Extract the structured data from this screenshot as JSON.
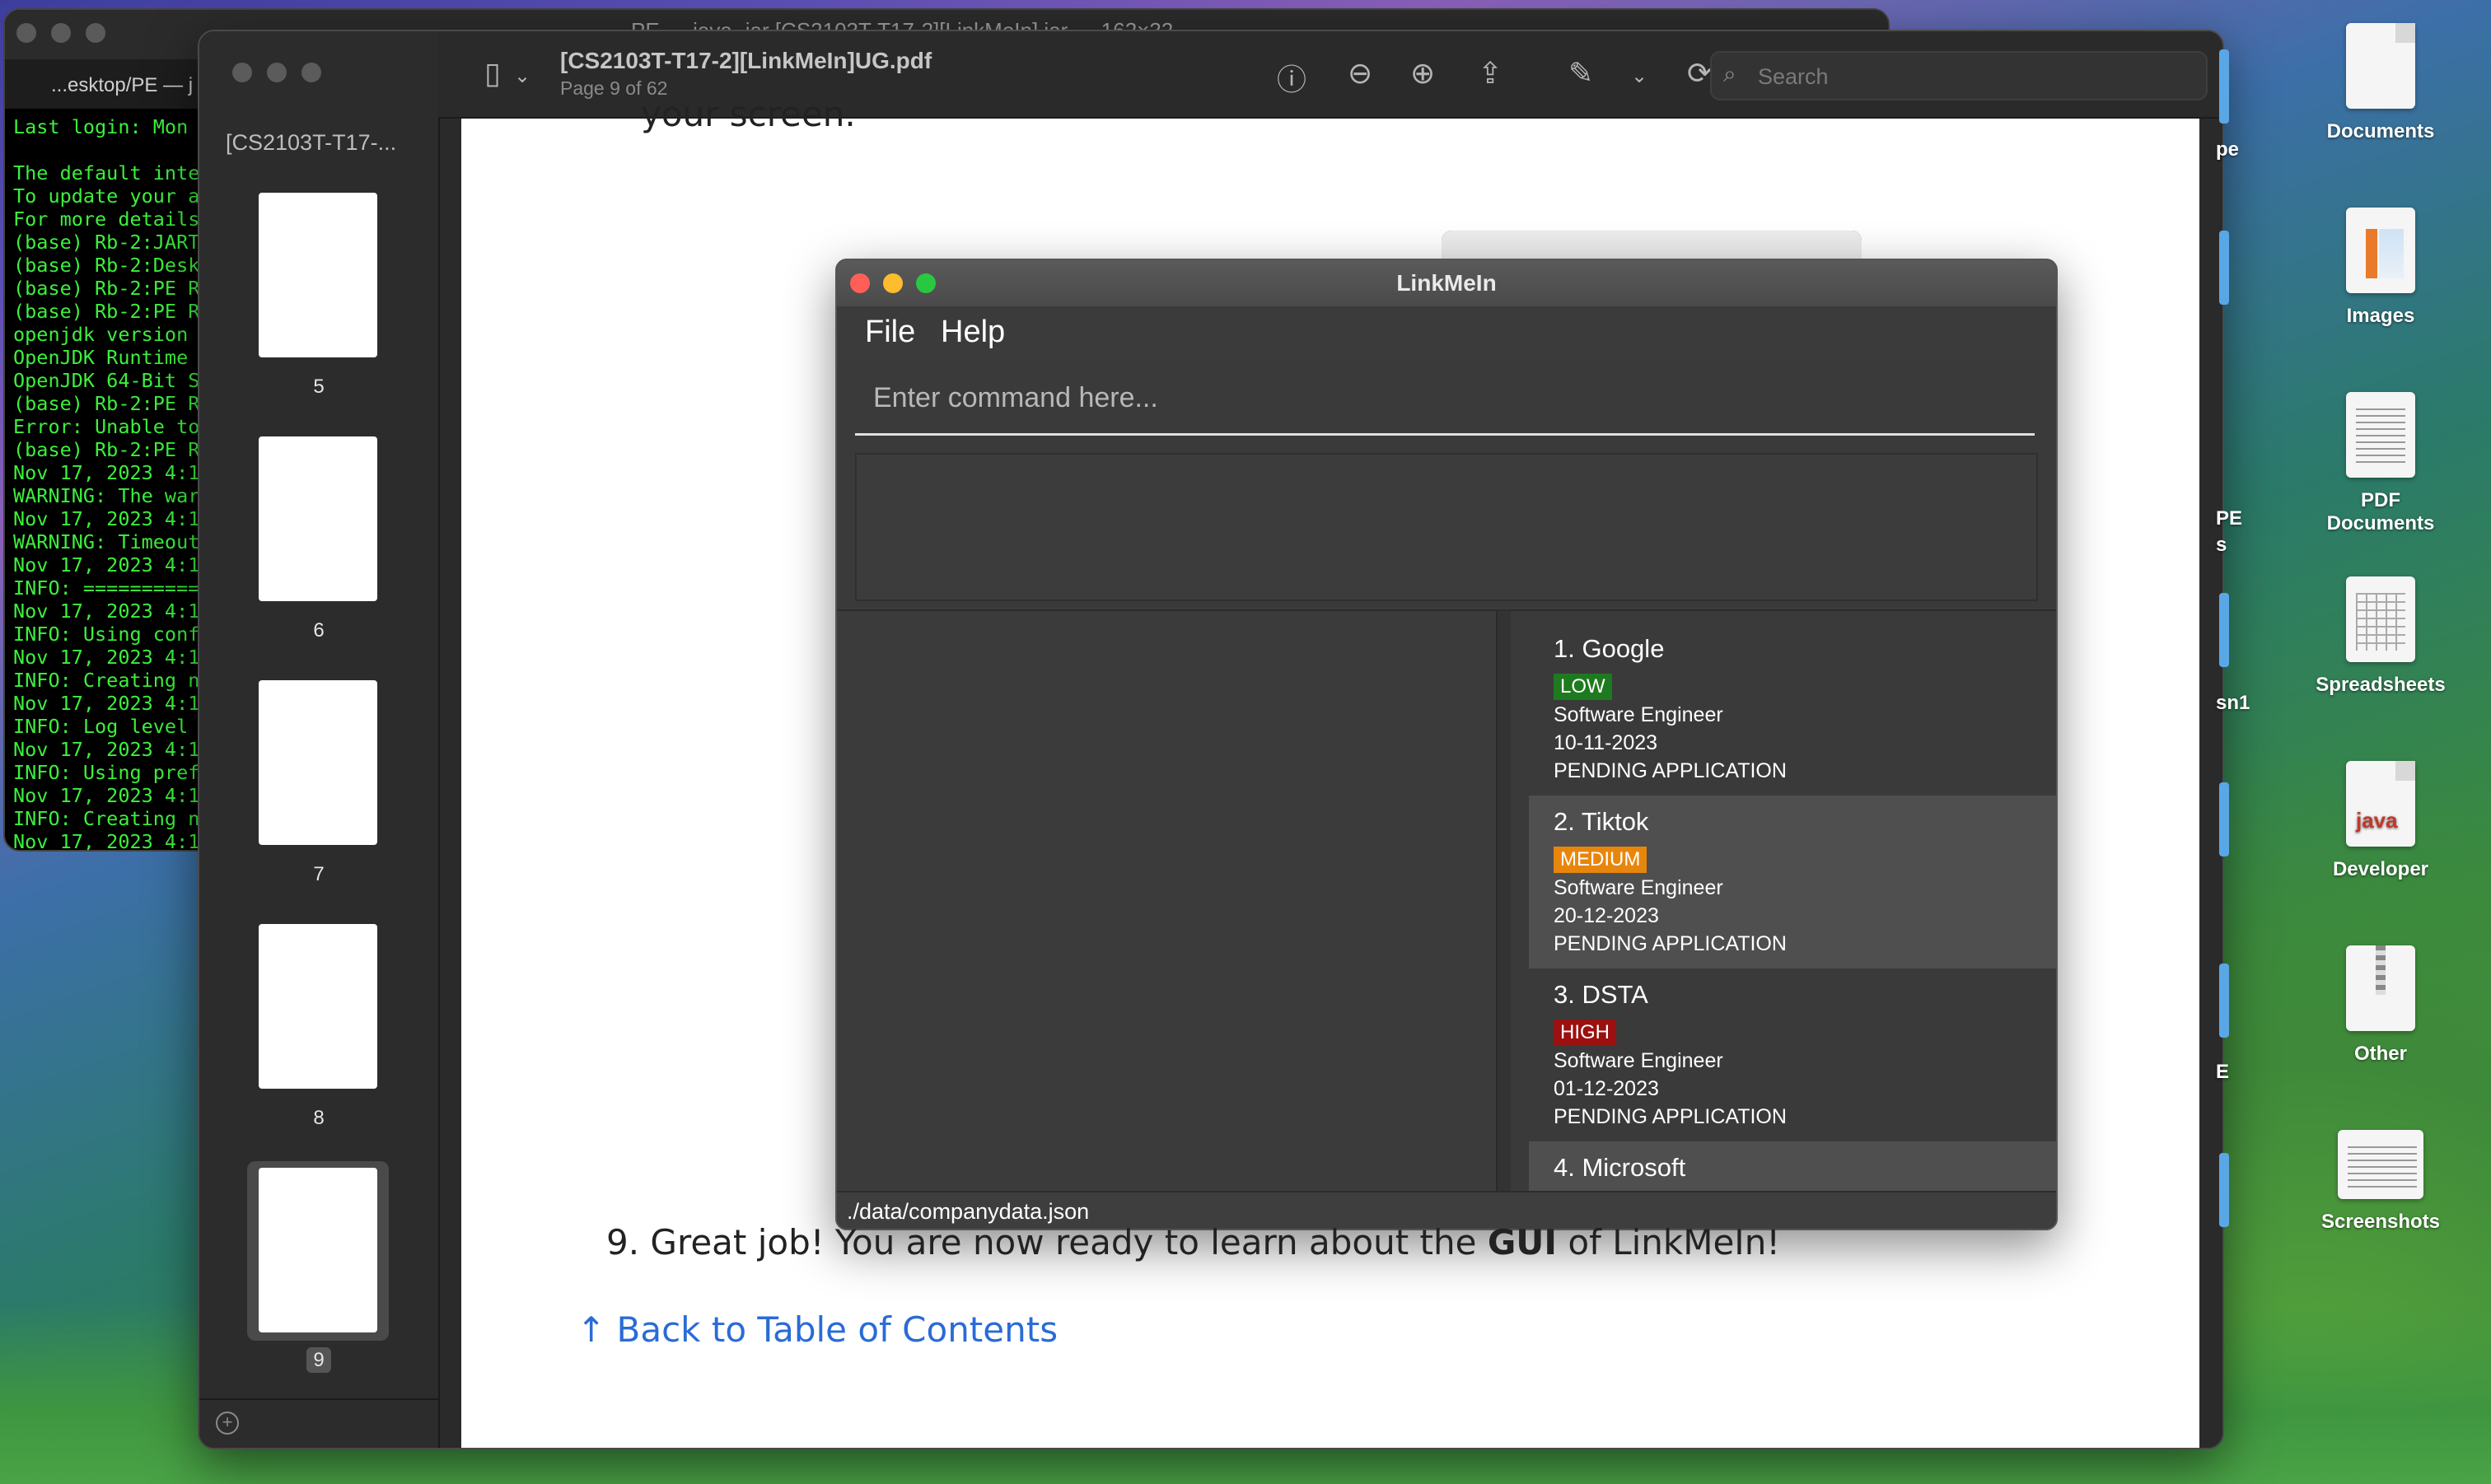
{
  "terminal": {
    "top_title": "PE — java -jar [CS2103T-T17-2][LinkMeIn].jar — 162×32",
    "tab_label": "...esktop/PE — j",
    "lines": [
      "Last login: Mon",
      "",
      "The default inte",
      "To update your a",
      "For more details",
      "(base) Rb-2:JART",
      "(base) Rb-2:Desk",
      "(base) Rb-2:PE R",
      "(base) Rb-2:PE R",
      "openjdk version",
      "OpenJDK Runtime",
      "OpenJDK 64-Bit S",
      "(base) Rb-2:PE R",
      "Error: Unable to",
      "(base) Rb-2:PE R",
      "Nov 17, 2023 4:1",
      "WARNING: The war",
      "Nov 17, 2023 4:1",
      "WARNING: Timeout",
      "Nov 17, 2023 4:1",
      "INFO: ==========",
      "Nov 17, 2023 4:1",
      "INFO: Using conf",
      "Nov 17, 2023 4:1",
      "INFO: Creating n",
      "Nov 17, 2023 4:1",
      "INFO: Log level",
      "Nov 17, 2023 4:1",
      "INFO: Using pref",
      "Nov 17, 2023 4:1",
      "INFO: Creating n",
      "Nov 17, 2023 4:1"
    ]
  },
  "preview": {
    "sidebar_title": "[CS2103T-T17-...",
    "doc_title": "[CS2103T-T17-2][LinkMeIn]UG.pdf",
    "page_info": "Page 9 of 62",
    "search_placeholder": "Search",
    "thumbnails": [
      {
        "num": "5"
      },
      {
        "num": "6"
      },
      {
        "num": "7"
      },
      {
        "num": "8"
      },
      {
        "num": "9"
      }
    ],
    "selected_page": "9",
    "doc_top_text": "your screen.",
    "step_prefix": "9. Great job! You are now ready to learn about the ",
    "step_bold": "GUI",
    "step_suffix": " of LinkMeIn!",
    "back_link": "↑ Back to Table of Contents"
  },
  "linkmein": {
    "title": "LinkMeIn",
    "menu": [
      "File",
      "Help"
    ],
    "command_placeholder": "Enter command here...",
    "status_path": "./data/companydata.json",
    "companies": [
      {
        "name": "1.  Google",
        "priority": "LOW",
        "priority_color": "#1e7a1e",
        "role": "Software Engineer",
        "date": "10-11-2023",
        "status": "PENDING APPLICATION"
      },
      {
        "name": "2.  Tiktok",
        "priority": "MEDIUM",
        "priority_color": "#e8860c",
        "role": "Software Engineer",
        "date": "20-12-2023",
        "status": "PENDING APPLICATION"
      },
      {
        "name": "3.  DSTA",
        "priority": "HIGH",
        "priority_color": "#9b1010",
        "role": "Software Engineer",
        "date": "01-12-2023",
        "status": "PENDING APPLICATION"
      },
      {
        "name": "4.  Microsoft"
      }
    ]
  },
  "desktop": {
    "icons": [
      "Documents",
      "Images",
      "PDF Documents",
      "Spreadsheets",
      "Developer",
      "Other",
      "Screenshots"
    ],
    "partial_labels": [
      "pe",
      "PE",
      "s",
      "sn1",
      "E"
    ]
  },
  "colors": {
    "terminal_text": "#3cf03c",
    "link": "#2a6bd6",
    "traffic_red": "#ff5f57",
    "traffic_yellow": "#febc2e",
    "traffic_green": "#28c840"
  }
}
